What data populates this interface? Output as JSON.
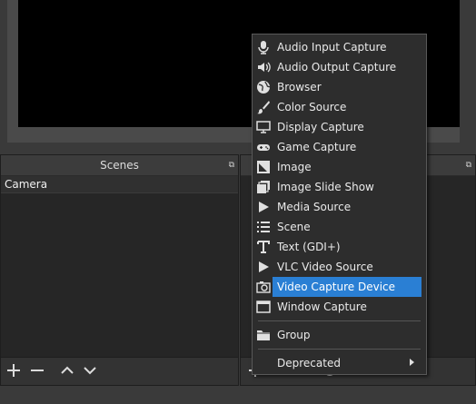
{
  "scenes_dock": {
    "title": "Scenes",
    "items": [
      {
        "label": "Camera"
      }
    ]
  },
  "context_menu": {
    "items": [
      {
        "label": "Audio Input Capture",
        "icon": "microphone-icon"
      },
      {
        "label": "Audio Output Capture",
        "icon": "speaker-icon"
      },
      {
        "label": "Browser",
        "icon": "globe-icon"
      },
      {
        "label": "Color Source",
        "icon": "paintbrush-icon"
      },
      {
        "label": "Display Capture",
        "icon": "monitor-icon"
      },
      {
        "label": "Game Capture",
        "icon": "gamepad-icon"
      },
      {
        "label": "Image",
        "icon": "image-icon"
      },
      {
        "label": "Image Slide Show",
        "icon": "slideshow-icon"
      },
      {
        "label": "Media Source",
        "icon": "play-icon"
      },
      {
        "label": "Scene",
        "icon": "list-icon"
      },
      {
        "label": "Text (GDI+)",
        "icon": "text-icon"
      },
      {
        "label": "VLC Video Source",
        "icon": "play-icon"
      },
      {
        "label": "Video Capture Device",
        "icon": "camera-icon",
        "selected": true
      },
      {
        "label": "Window Capture",
        "icon": "window-icon"
      },
      {
        "label": "Group",
        "icon": "folder-icon"
      },
      {
        "label": "Deprecated",
        "icon": ""
      }
    ]
  },
  "colors": {
    "selection": "#2a7fd4",
    "menu_bg": "#2d2d2d",
    "dock_bg": "#2b2b2b"
  }
}
